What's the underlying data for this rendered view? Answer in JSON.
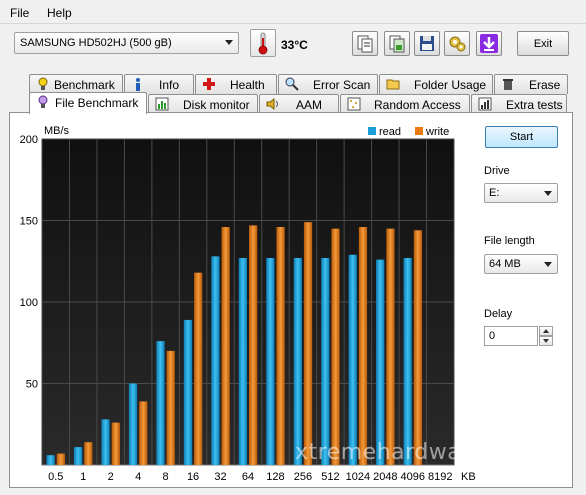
{
  "menu": {
    "file": "File",
    "help": "Help"
  },
  "toolbar": {
    "drive": "SAMSUNG HD502HJ (500 gB)",
    "temperature": "33°C",
    "exit_label": "Exit"
  },
  "tabs_top": [
    {
      "label": "Benchmark",
      "icon": "benchmark-icon"
    },
    {
      "label": "Info",
      "icon": "info-icon"
    },
    {
      "label": "Health",
      "icon": "health-icon"
    },
    {
      "label": "Error Scan",
      "icon": "error-scan-icon"
    },
    {
      "label": "Folder Usage",
      "icon": "folder-icon"
    },
    {
      "label": "Erase",
      "icon": "erase-icon"
    }
  ],
  "tabs_bottom": [
    {
      "label": "File Benchmark",
      "icon": "file-benchmark-icon"
    },
    {
      "label": "Disk monitor",
      "icon": "disk-monitor-icon"
    },
    {
      "label": "AAM",
      "icon": "speaker-icon"
    },
    {
      "label": "Random Access",
      "icon": "random-access-icon"
    },
    {
      "label": "Extra tests",
      "icon": "extra-tests-icon"
    }
  ],
  "chart_data": {
    "type": "bar",
    "ylabel": "MB/s",
    "xlabel": "KB",
    "ylim": [
      0,
      200
    ],
    "yticks": [
      50,
      100,
      150,
      200
    ],
    "categories": [
      "0.5",
      "1",
      "2",
      "4",
      "8",
      "16",
      "32",
      "64",
      "128",
      "256",
      "512",
      "1024",
      "2048",
      "4096",
      "8192"
    ],
    "series": [
      {
        "name": "read",
        "color": "#1b9fd8",
        "values": [
          6,
          11,
          28,
          50,
          76,
          89,
          128,
          127,
          127,
          127,
          127,
          129,
          126,
          127,
          null
        ]
      },
      {
        "name": "write",
        "color": "#e87a14",
        "values": [
          7,
          14,
          26,
          39,
          70,
          118,
          146,
          147,
          146,
          149,
          145,
          146,
          145,
          144,
          null
        ]
      }
    ],
    "grid": true,
    "legend": "top-right"
  },
  "side": {
    "start_label": "Start",
    "drive_label": "Drive",
    "drive_value": "E:",
    "file_length_label": "File length",
    "file_length_value": "64 MB",
    "delay_label": "Delay",
    "delay_value": "0"
  },
  "watermark": "xtremehardware.it"
}
